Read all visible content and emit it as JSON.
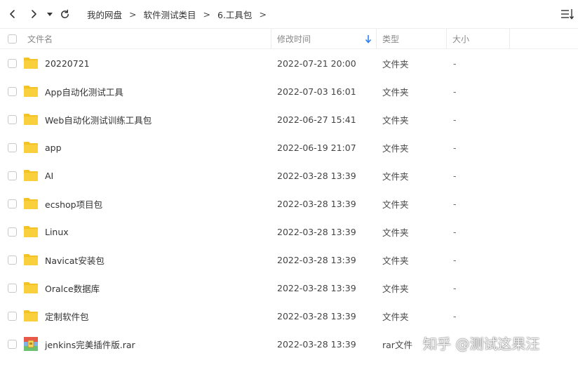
{
  "breadcrumb": [
    {
      "label": "我的网盘"
    },
    {
      "label": "软件测试类目"
    },
    {
      "label": "6.工具包"
    }
  ],
  "breadcrumb_separator": ">",
  "columns": {
    "name": "文件名",
    "modified": "修改时间",
    "type": "类型",
    "size": "大小"
  },
  "sort": {
    "column": "modified",
    "direction": "descending"
  },
  "files": [
    {
      "name": "20220721",
      "modified": "2022-07-21 20:00",
      "type": "文件夹",
      "size": "-",
      "icon": "folder-icon"
    },
    {
      "name": "App自动化测试工具",
      "modified": "2022-07-03 16:01",
      "type": "文件夹",
      "size": "-",
      "icon": "folder-icon"
    },
    {
      "name": "Web自动化测试训练工具包",
      "modified": "2022-06-27 15:41",
      "type": "文件夹",
      "size": "-",
      "icon": "folder-icon"
    },
    {
      "name": "app",
      "modified": "2022-06-19 21:07",
      "type": "文件夹",
      "size": "-",
      "icon": "folder-icon"
    },
    {
      "name": "AI",
      "modified": "2022-03-28 13:39",
      "type": "文件夹",
      "size": "-",
      "icon": "folder-icon"
    },
    {
      "name": "ecshop项目包",
      "modified": "2022-03-28 13:39",
      "type": "文件夹",
      "size": "-",
      "icon": "folder-icon"
    },
    {
      "name": "Linux",
      "modified": "2022-03-28 13:39",
      "type": "文件夹",
      "size": "-",
      "icon": "folder-icon"
    },
    {
      "name": "Navicat安装包",
      "modified": "2022-03-28 13:39",
      "type": "文件夹",
      "size": "-",
      "icon": "folder-icon"
    },
    {
      "name": "Oralce数据库",
      "modified": "2022-03-28 13:39",
      "type": "文件夹",
      "size": "-",
      "icon": "folder-icon"
    },
    {
      "name": "定制软件包",
      "modified": "2022-03-28 13:39",
      "type": "文件夹",
      "size": "-",
      "icon": "folder-icon"
    },
    {
      "name": "jenkins完美插件版.rar",
      "modified": "2022-03-28 13:39",
      "type": "rar文件",
      "size": "",
      "icon": "rar-archive-icon"
    }
  ],
  "watermark": "知乎 @测试这果汪",
  "colors": {
    "folder": "#f5c226",
    "folder_tab": "#e8b01b",
    "sort_arrow": "#2f7ff0",
    "divider": "#ececec"
  },
  "icons": {
    "back": "chevron-left-icon",
    "forward": "chevron-right-icon",
    "history": "caret-down-icon",
    "refresh": "refresh-icon",
    "sort_toggle": "sort-list-icon",
    "sort_indicator": "arrow-down-icon"
  }
}
